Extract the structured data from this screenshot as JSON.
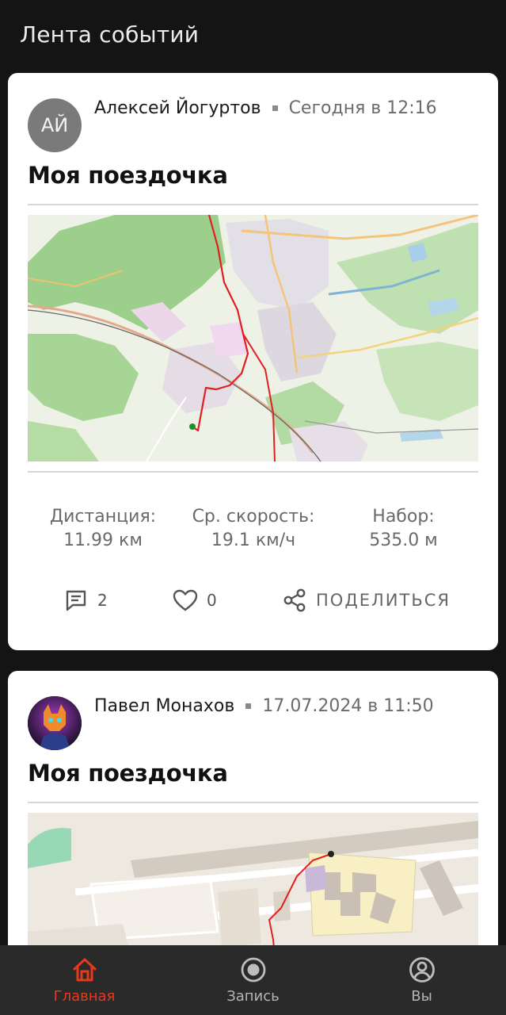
{
  "header": {
    "title": "Лента событий"
  },
  "posts": [
    {
      "author": {
        "name": "Алексей Йогуртов",
        "initials": "АЙ"
      },
      "time": "Сегодня в 12:16",
      "title": "Моя поездочка",
      "stats": [
        {
          "label": "Дистанция:",
          "value": "11.99 км"
        },
        {
          "label": "Ср. скорость:",
          "value": "19.1 км/ч"
        },
        {
          "label": "Набор:",
          "value": "535.0 м"
        }
      ],
      "actions": {
        "comments_count": "2",
        "likes_count": "0",
        "share_label": "ПОДЕЛИТЬСЯ"
      }
    },
    {
      "author": {
        "name": "Павел Монахов"
      },
      "time": "17.07.2024 в 11:50",
      "title": "Моя поездочка"
    }
  ],
  "nav": [
    {
      "label": "Главная",
      "icon": "home-icon",
      "active": true
    },
    {
      "label": "Запись",
      "icon": "record-icon",
      "active": false
    },
    {
      "label": "Вы",
      "icon": "profile-icon",
      "active": false
    }
  ],
  "colors": {
    "accent": "#e63a1c",
    "route": "#e02020",
    "start_marker": "#1f8f2f",
    "background": "#141414",
    "card": "#ffffff"
  }
}
